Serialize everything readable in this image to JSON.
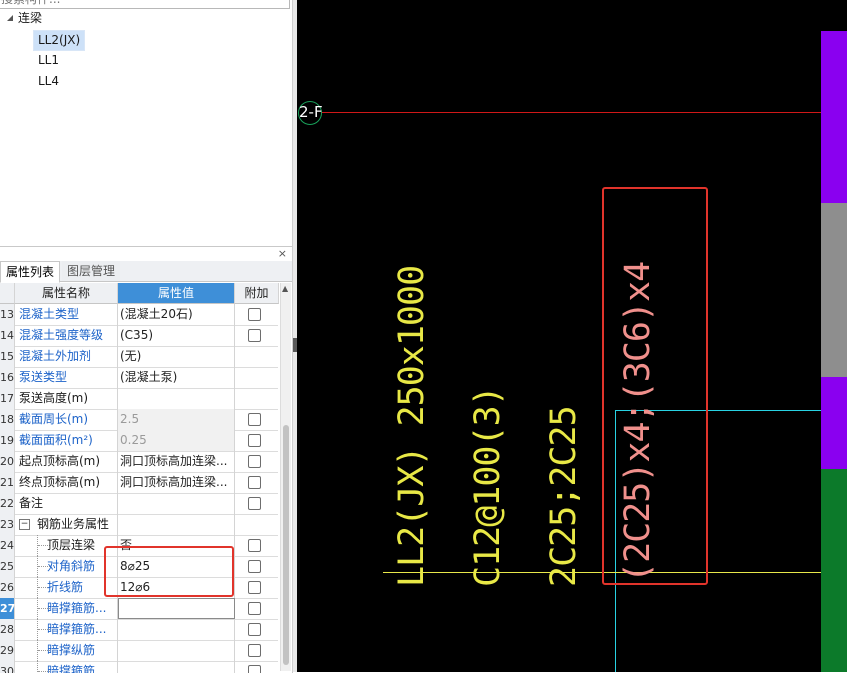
{
  "tree": {
    "search_placeholder": "搜索构件...",
    "root_label": "连梁",
    "items": [
      "LL2(JX)",
      "LL1",
      "LL4"
    ],
    "selected_index": 0
  },
  "properties_panel": {
    "close_glyph": "×",
    "tabs": [
      {
        "label": "属性列表",
        "active": true
      },
      {
        "label": "图层管理",
        "active": false
      }
    ],
    "columns": {
      "name": "属性名称",
      "value": "属性值",
      "extra": "附加"
    },
    "rows": [
      {
        "num": "13",
        "name": "混凝土类型",
        "value": "(混凝土20石)",
        "name_color": "blue",
        "checkbox": true
      },
      {
        "num": "14",
        "name": "混凝土强度等级",
        "value": "(C35)",
        "name_color": "blue",
        "checkbox": true
      },
      {
        "num": "15",
        "name": "混凝土外加剂",
        "value": "(无)",
        "name_color": "blue",
        "checkbox": false
      },
      {
        "num": "16",
        "name": "泵送类型",
        "value": "(混凝土泵)",
        "name_color": "blue",
        "checkbox": false
      },
      {
        "num": "17",
        "name": "泵送高度(m)",
        "value": "",
        "name_color": "black",
        "checkbox": false
      },
      {
        "num": "18",
        "name": "截面周长(m)",
        "value": "2.5",
        "name_color": "blue",
        "checkbox": true,
        "value_grey": true
      },
      {
        "num": "19",
        "name": "截面面积(m²)",
        "value": "0.25",
        "name_color": "blue",
        "checkbox": true,
        "value_grey": true
      },
      {
        "num": "20",
        "name": "起点顶标高(m)",
        "value": "洞口顶标高加连梁...",
        "name_color": "black",
        "checkbox": true
      },
      {
        "num": "21",
        "name": "终点顶标高(m)",
        "value": "洞口顶标高加连梁...",
        "name_color": "black",
        "checkbox": true
      },
      {
        "num": "22",
        "name": "备注",
        "value": "",
        "name_color": "black",
        "checkbox": true
      },
      {
        "num": "23",
        "name": "钢筋业务属性",
        "value": "",
        "name_color": "black",
        "checkbox": false,
        "group": true,
        "collapse_glyph": "−"
      },
      {
        "num": "24",
        "name": "顶层连梁",
        "value": "否",
        "name_color": "black",
        "checkbox": true,
        "child": true
      },
      {
        "num": "25",
        "name": "对角斜筋",
        "value": "8⌀25",
        "name_color": "blue",
        "checkbox": true,
        "child": true
      },
      {
        "num": "26",
        "name": "折线筋",
        "value": "12⌀6",
        "name_color": "blue",
        "checkbox": true,
        "child": true
      },
      {
        "num": "27",
        "name": "暗撑箍筋...",
        "value": "",
        "name_color": "blue",
        "checkbox": true,
        "child": true,
        "selected": true,
        "editing": true
      },
      {
        "num": "28",
        "name": "暗撑箍筋...",
        "value": "",
        "name_color": "blue",
        "checkbox": true,
        "child": true
      },
      {
        "num": "29",
        "name": "暗撑纵筋",
        "value": "",
        "name_color": "blue",
        "checkbox": true,
        "child": true
      },
      {
        "num": "30",
        "name": "暗撑箍筋",
        "value": "",
        "name_color": "blue",
        "checkbox": true,
        "child": true
      }
    ],
    "scroll_up_glyph": "▲"
  },
  "cad": {
    "axis_label": "2-F",
    "beam_name": "LL2(JX) 250x1000",
    "stirrup": "C12@100(3)",
    "longitudinal": "2C25;2C25",
    "diagonal": "(2C25)x4;(3C6)x4",
    "colors": {
      "annotation_yellow": "#e8e846",
      "annotation_pink": "#f0908c",
      "axis_red": "#d01818",
      "cyan": "#28d2e2",
      "highlight_red": "#e1342b",
      "column_purple": "#8a00f0",
      "column_grey": "#8e8e8e",
      "column_green": "#0c7a2a"
    }
  }
}
